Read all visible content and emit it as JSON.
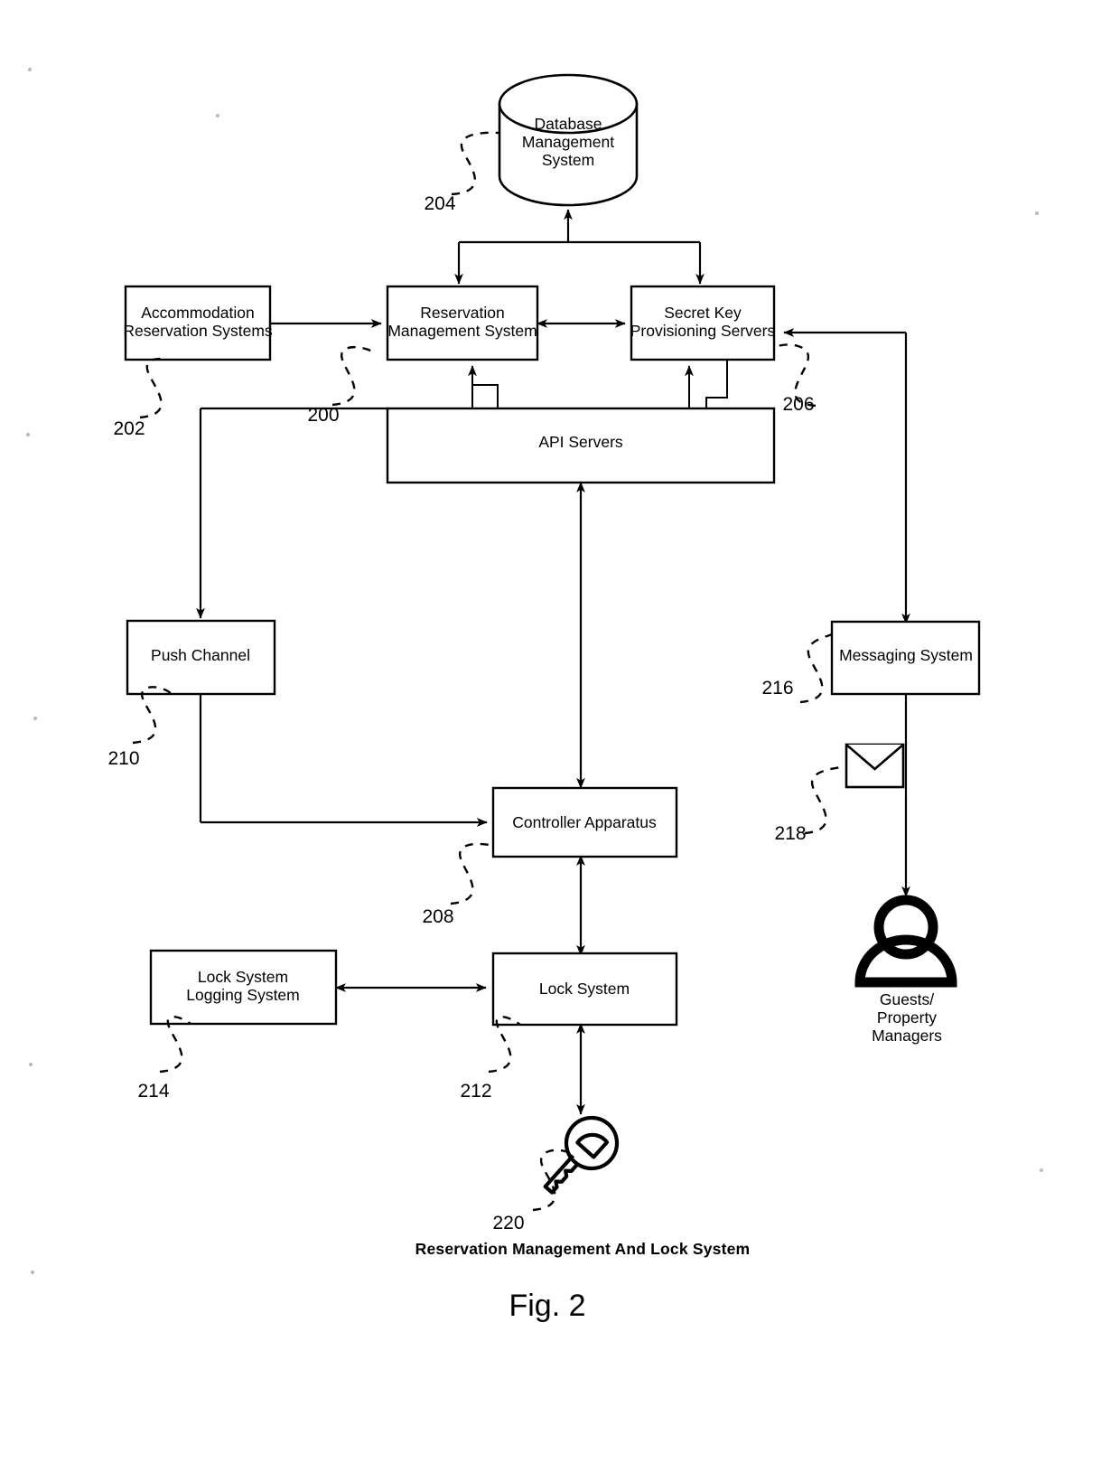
{
  "figure": {
    "caption": "Reservation Management And Lock System",
    "figure_label": "Fig. 2"
  },
  "nodes": {
    "dbms": {
      "label_lines": [
        "Database",
        "Management",
        "System"
      ],
      "ref": "204",
      "shape": "cylinder"
    },
    "accommodation": {
      "label_lines": [
        "Accommodation",
        "Reservation Systems"
      ],
      "ref": "202",
      "shape": "rect"
    },
    "reservation_mgmt": {
      "label_lines": [
        "Reservation",
        "Management System"
      ],
      "ref": "200",
      "shape": "rect"
    },
    "secret_key": {
      "label_lines": [
        "Secret Key",
        "Provisioning Servers"
      ],
      "ref": "206",
      "shape": "rect"
    },
    "api_servers": {
      "label_lines": [
        "API Servers"
      ],
      "ref": "",
      "shape": "rect"
    },
    "push_channel": {
      "label_lines": [
        "Push Channel"
      ],
      "ref": "210",
      "shape": "rect"
    },
    "messaging_system": {
      "label_lines": [
        "Messaging System"
      ],
      "ref": "216",
      "shape": "rect"
    },
    "envelope": {
      "label_lines": [],
      "ref": "218",
      "shape": "envelope-icon"
    },
    "controller": {
      "label_lines": [
        "Controller Apparatus"
      ],
      "ref": "208",
      "shape": "rect"
    },
    "lock_logging": {
      "label_lines": [
        "Lock System",
        "Logging System"
      ],
      "ref": "214",
      "shape": "rect"
    },
    "lock_system": {
      "label_lines": [
        "Lock System"
      ],
      "ref": "212",
      "shape": "rect"
    },
    "key": {
      "label_lines": [],
      "ref": "220",
      "shape": "key-icon"
    },
    "guests": {
      "label_lines": [
        "Guests/",
        "Property",
        "Managers"
      ],
      "ref": "",
      "shape": "person-icon"
    }
  },
  "refs": {
    "r200": "200",
    "r202": "202",
    "r204": "204",
    "r206": "206",
    "r208": "208",
    "r210": "210",
    "r212": "212",
    "r214": "214",
    "r216": "216",
    "r218": "218",
    "r220": "220"
  },
  "colors": {
    "stroke": "#000000",
    "fill": "#ffffff",
    "background": "#ffffff"
  }
}
